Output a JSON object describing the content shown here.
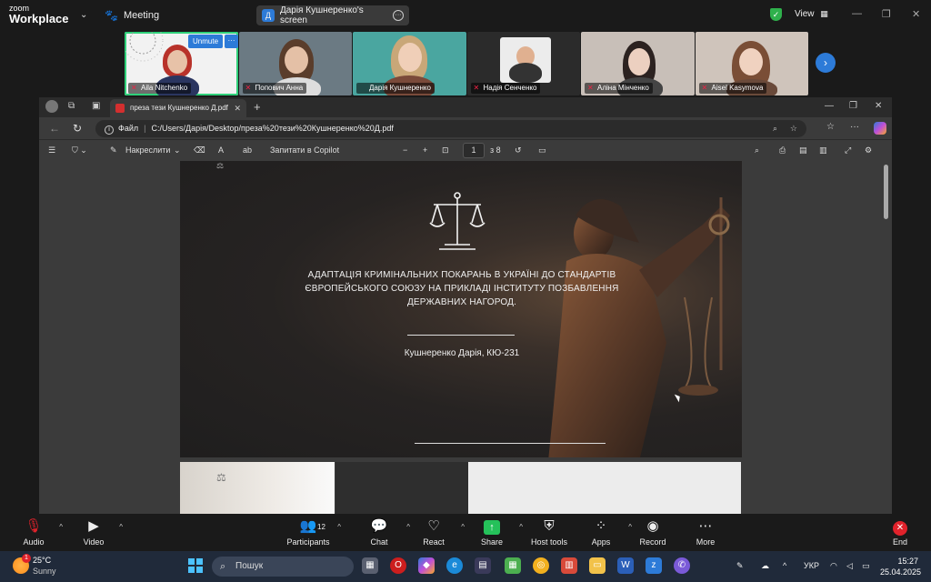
{
  "zoom": {
    "logo_line1": "zoom",
    "logo_line2": "Workplace",
    "meeting_label": "Meeting",
    "share_badge": "Д",
    "share_label": "Дарія Кушнеренко's screen",
    "view_label": "View",
    "accent": "#2d7bd8",
    "participants": [
      {
        "name": "Aila Nitchenko",
        "bg": "#f2f2f2",
        "unmute": "Unmute"
      },
      {
        "name": "Попович Анна",
        "bg": "#6b7a83"
      },
      {
        "name": "Дарія Кушнеренко",
        "bg": "#4aa6a0"
      },
      {
        "name": "Надія Сенченко",
        "bg": "#3a3a3a"
      },
      {
        "name": "Аліна Мінченко",
        "bg": "#c8bfb8"
      },
      {
        "name": "Aisel Kasymova",
        "bg": "#cfc4bb"
      }
    ]
  },
  "browser": {
    "tab_title": "преза тези Кушнеренко Д.pdf",
    "address_prefix": "Файл",
    "address": "C:/Users/Дарія/Desktop/преза%20тези%20Кушнеренко%20Д.pdf",
    "toolbar": {
      "draw_label": "Накреслити",
      "copilot_label": "Запитати в Copilot",
      "page_current": "1",
      "page_total": "з 8"
    }
  },
  "slide": {
    "title": "АДАПТАЦІЯ КРИМІНАЛЬНИХ ПОКАРАНЬ В УКРАЇНІ ДО СТАНДАРТІВ ЄВРОПЕЙСЬКОГО СОЮЗУ НА ПРИКЛАДІ ІНСТИТУТУ ПОЗБАВЛЕННЯ ДЕРЖАВНИХ НАГОРОД.",
    "author": "Кушнеренко Дарія, КЮ-231"
  },
  "controls": {
    "audio": "Audio",
    "video": "Video",
    "participants": "Participants",
    "participants_count": "12",
    "chat": "Chat",
    "react": "React",
    "share": "Share",
    "host_tools": "Host tools",
    "apps": "Apps",
    "record": "Record",
    "more": "More",
    "end": "End"
  },
  "taskbar": {
    "weather_temp": "25°C",
    "weather_desc": "Sunny",
    "weather_alert": "1",
    "search_placeholder": "Пошук",
    "lang": "УКР",
    "time": "15:27",
    "date": "25.04.2025"
  }
}
